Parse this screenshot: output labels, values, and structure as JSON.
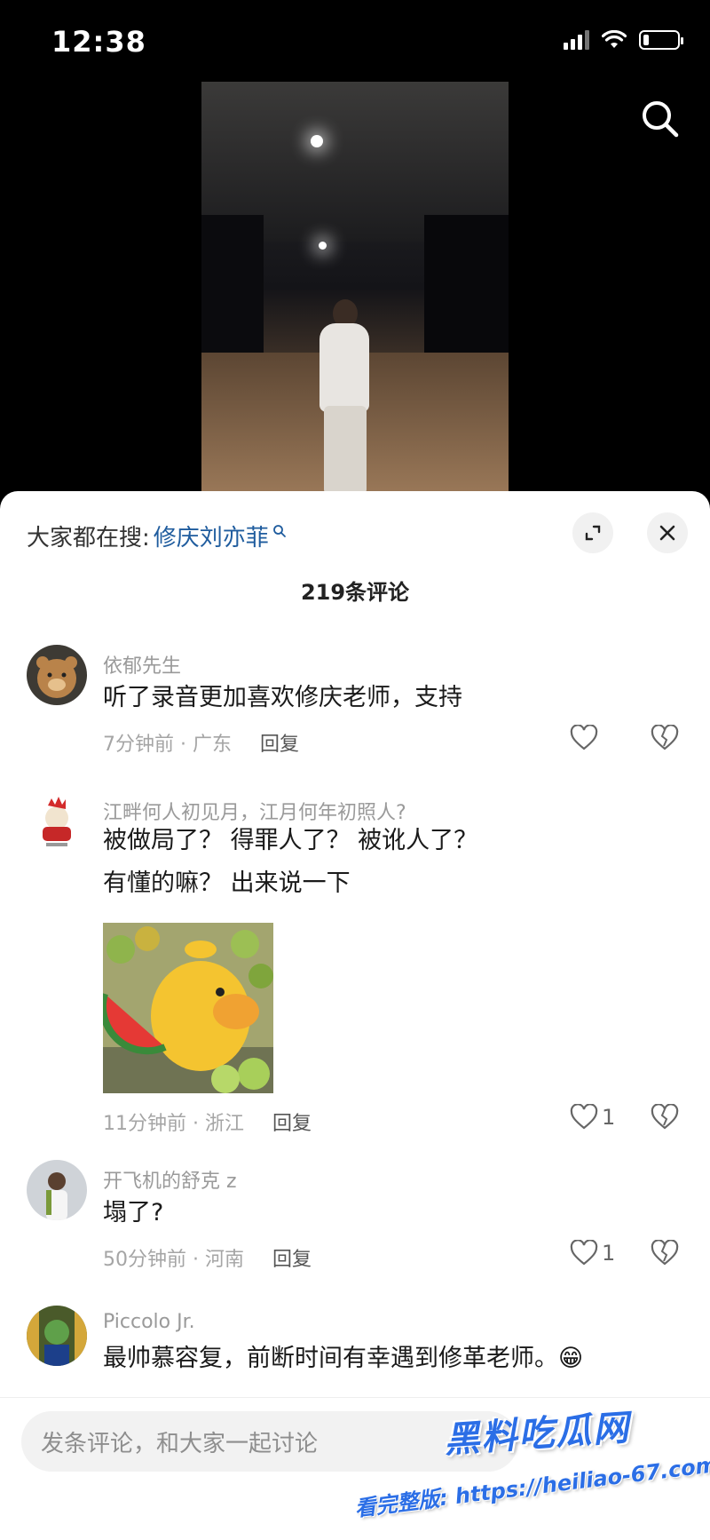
{
  "status_bar": {
    "time": "12:38",
    "icons": [
      "signal-icon",
      "wifi-icon",
      "battery-icon"
    ]
  },
  "video": {
    "search_icon": "search-icon"
  },
  "sheet": {
    "hot_search_label": "大家都在搜:",
    "hot_search_term": "修庆刘亦菲",
    "comment_count": "219条评论",
    "expand_icon": "expand-icon",
    "close_icon": "close-icon"
  },
  "comments": [
    {
      "username": "依郁先生",
      "lines": [
        "听了录音更加喜欢修庆老师，支持"
      ],
      "time_location": "7分钟前 · 广东",
      "reply": "回复",
      "likes": ""
    },
    {
      "username": "江畔何人初见月，江月何年初照人?",
      "lines": [
        "被做局了？ 得罪人了？ 被讹人了？",
        " 有懂的嘛？ 出来说一下"
      ],
      "time_location": "11分钟前 · 浙江",
      "reply": "回复",
      "likes": "1"
    },
    {
      "username": "开飞机的舒克 z",
      "lines": [
        "塌了?"
      ],
      "time_location": "50分钟前 · 河南",
      "reply": "回复",
      "likes": "1"
    },
    {
      "username": "Piccolo Jr.",
      "lines": [
        "最帅慕容复，前断时间有幸遇到修革老师。😁"
      ],
      "time_location": "",
      "reply": "",
      "likes": ""
    }
  ],
  "input": {
    "placeholder": "发条评论，和大家一起讨论"
  },
  "watermark": {
    "title": "黑料吃瓜网",
    "url": "看完整版: https://heiliao-67.com"
  },
  "colors": {
    "accent": "#1f5c9e",
    "watermark": "#2b6ee6",
    "sheet_bg": "#ffffff"
  }
}
